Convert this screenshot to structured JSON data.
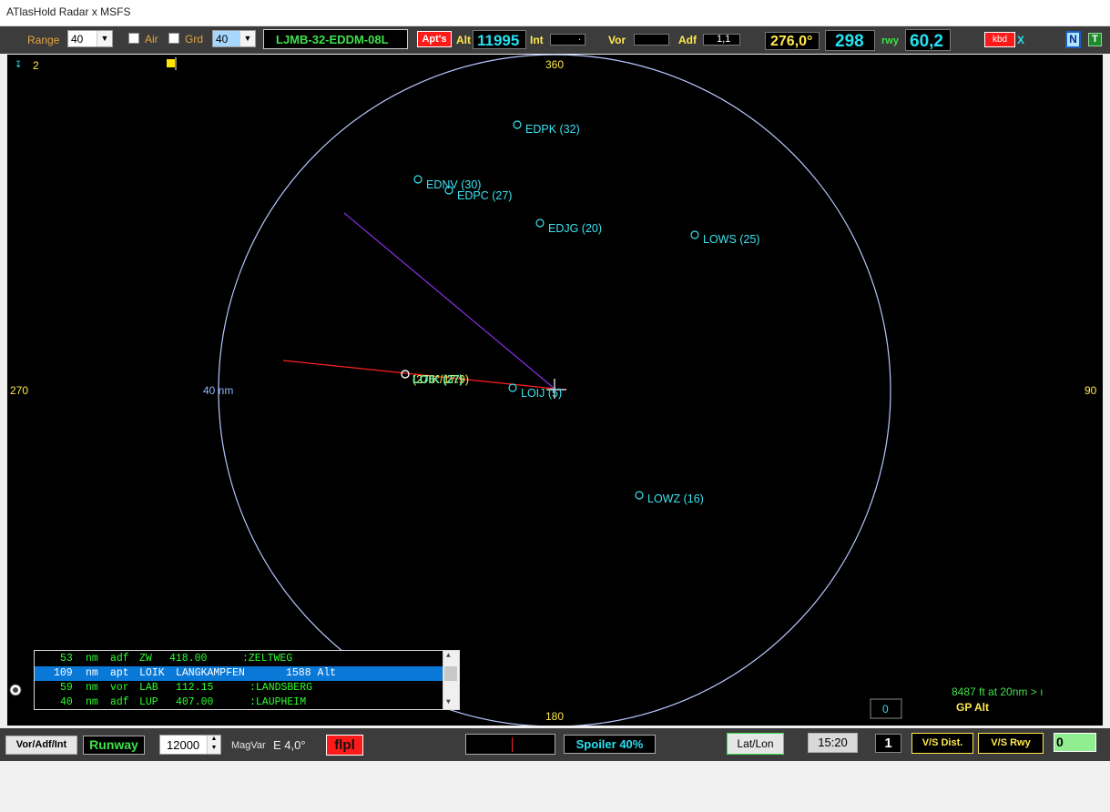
{
  "window": {
    "title": "ATlasHold Radar x MSFS"
  },
  "toolbar": {
    "range_label": "Range",
    "range_value": "40",
    "air_label": "Air",
    "grd_label": "Grd",
    "grd_value": "40",
    "route": "LJMB-32-EDDM-08L",
    "apts_button": "Apt's",
    "alt_label": "Alt",
    "alt_value": "11995",
    "int_label": "Int",
    "int_value": ".",
    "vor_label": "Vor",
    "vor_value": "",
    "adf_label": "Adf",
    "adf_value": "1,1",
    "heading": "276,0°",
    "speed": "298",
    "rwy_label": "rwy",
    "rwy_value": "60,2",
    "kbd_button": "kbd",
    "x_label": "X",
    "n_button": "N",
    "t_button": "T"
  },
  "radar": {
    "marker_count": "2",
    "compass": {
      "north": "360",
      "east": "90",
      "south": "180",
      "west": "270"
    },
    "range_ring_label": "40 nm",
    "aircraft_label": "(276°/17.9)",
    "waypoints": [
      {
        "id": "EDPK (32)"
      },
      {
        "id": "EDNV (30)"
      },
      {
        "id": "EDPC (27)"
      },
      {
        "id": "EDJG (20)"
      },
      {
        "id": "LOWS (25)"
      },
      {
        "id": "LOIK (27)"
      },
      {
        "id": "LOIJ (5)"
      },
      {
        "id": "LOWZ (16)"
      }
    ],
    "gp_info": "8487 ft at 20nm > ı",
    "gp_alt_label": "GP Alt",
    "zero_box": "0"
  },
  "nav_list": {
    "rows": [
      {
        "dist": "53",
        "unit": "nm",
        "type": "adf",
        "ident": "ZW",
        "freq": "418.00",
        "name": ":ZELTWEG",
        "selected": false
      },
      {
        "dist": "109",
        "unit": "nm",
        "type": "apt",
        "ident": "LOIK",
        "freq": "LANGKAMPFEN",
        "name": "1588 Alt",
        "selected": true
      },
      {
        "dist": "59",
        "unit": "nm",
        "type": "vor",
        "ident": "LAB",
        "freq": "112.15",
        "name": ":LANDSBERG",
        "selected": false
      },
      {
        "dist": "40",
        "unit": "nm",
        "type": "adf",
        "ident": "LUP",
        "freq": "407.00",
        "name": ":LAUPHEIM",
        "selected": false
      }
    ]
  },
  "bottom": {
    "vor_adf_int_button": "Vor/Adf/Int",
    "runway_button": "Runway",
    "altitude_value": "12000",
    "magvar_label": "MagVar",
    "magvar_value": "E 4,0°",
    "flpl_button": "flpl",
    "spoiler": "Spoiler 40%",
    "latlon_button": "Lat/Lon",
    "time": "15:20",
    "counter": "1",
    "vs_dist_button": "V/S Dist.",
    "vs_rwy_button": "V/S Rwy",
    "vs_value": "0"
  },
  "colors": {
    "cyan": "#27e0f0",
    "yellow": "#ffe94a",
    "green": "#3ee04a",
    "red": "#ff1a1a",
    "ring": "#b8c8ff"
  }
}
